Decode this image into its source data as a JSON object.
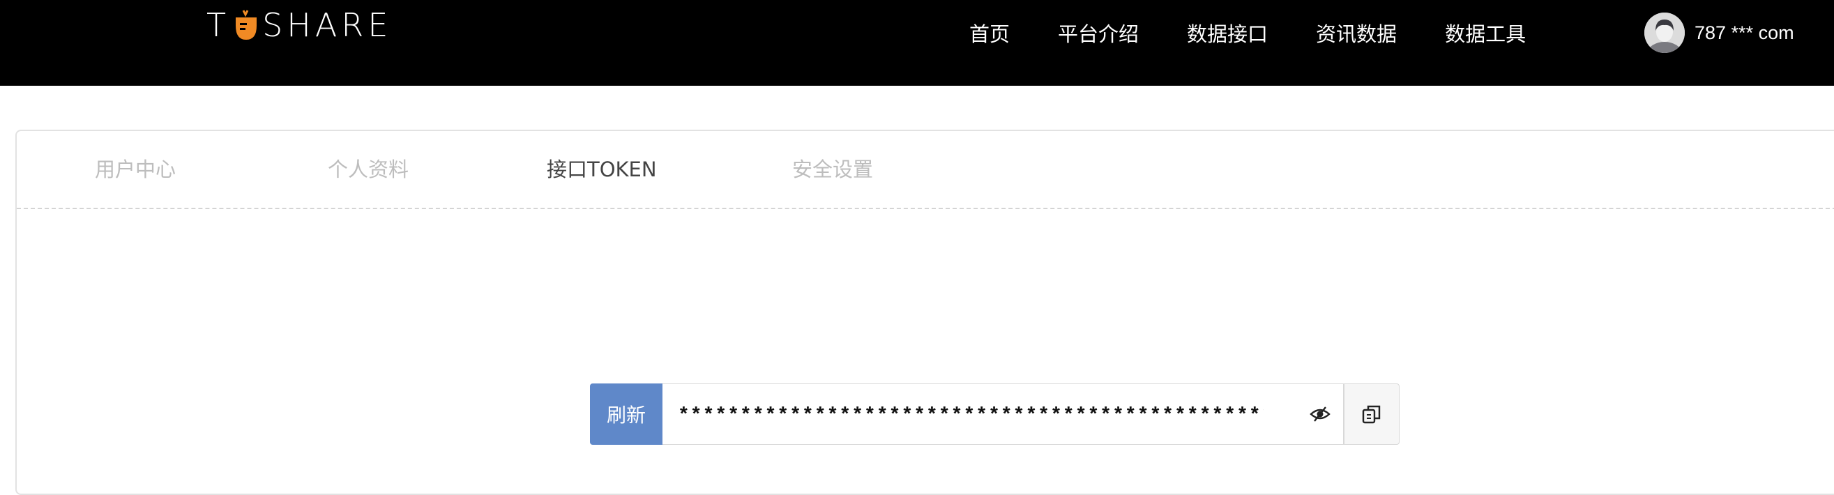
{
  "header": {
    "logo_letter_t": "T",
    "logo_rest": "SHARE",
    "logo_accent": "#f08a24",
    "nav": [
      {
        "label": "首页"
      },
      {
        "label": "平台介绍"
      },
      {
        "label": "数据接口"
      },
      {
        "label": "资讯数据"
      },
      {
        "label": "数据工具"
      }
    ],
    "user": {
      "name": "787 *** com",
      "avatar_icon": "user-avatar-icon"
    }
  },
  "tabs": [
    {
      "label": "用户中心",
      "active": false
    },
    {
      "label": "个人资料",
      "active": false
    },
    {
      "label": "接口TOKEN",
      "active": true
    },
    {
      "label": "安全设置",
      "active": false
    }
  ],
  "token": {
    "refresh_label": "刷新",
    "masked_value": "*******************************************************",
    "eye_icon": "eye-hidden-icon",
    "copy_icon": "copy-icon"
  },
  "colors": {
    "header_bg": "#000000",
    "refresh_bg": "#5f88c9",
    "tab_inactive": "#bdbdbd",
    "tab_active": "#444444"
  }
}
